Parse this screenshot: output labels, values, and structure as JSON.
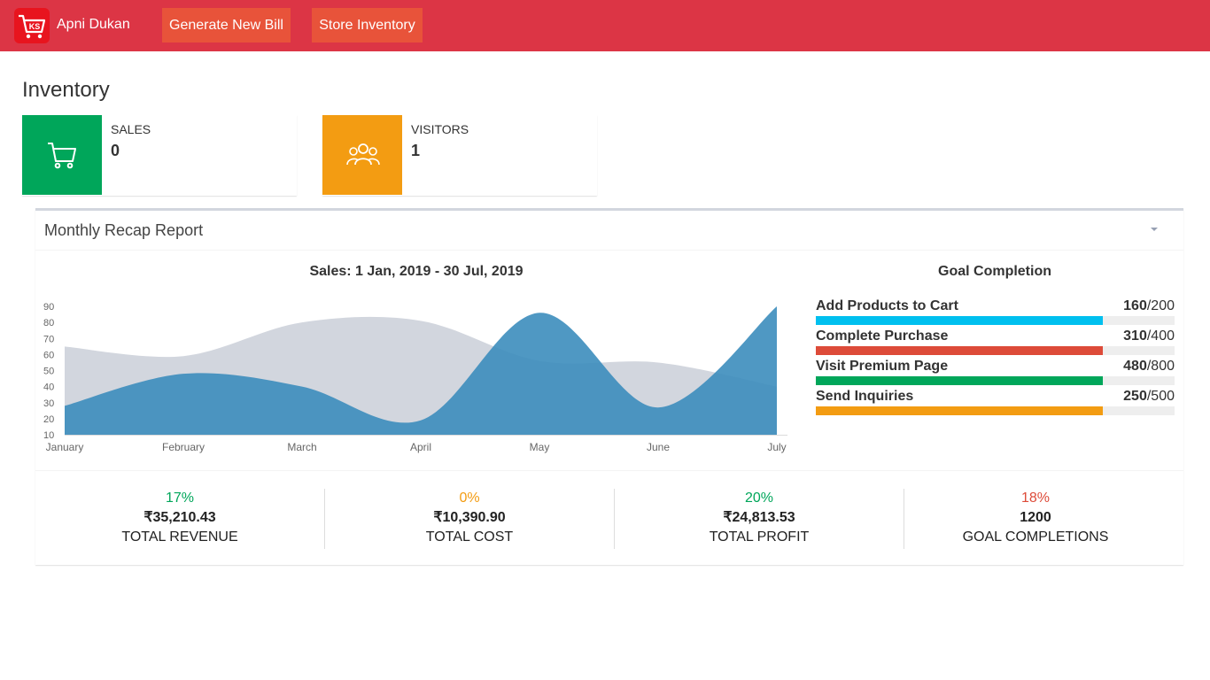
{
  "navbar": {
    "brand_name": "Apni Dukan",
    "brand_logo_text": "KS",
    "generate_bill_label": "Generate New Bill",
    "store_inventory_label": "Store Inventory"
  },
  "page": {
    "title": "Inventory"
  },
  "info_boxes": {
    "sales": {
      "label": "SALES",
      "value": "0",
      "icon": "cart-icon",
      "color": "#00a65a"
    },
    "visitors": {
      "label": "VISITORS",
      "value": "1",
      "icon": "users-icon",
      "color": "#f39c12"
    }
  },
  "report": {
    "title": "Monthly Recap Report",
    "goal_title": "Goal Completion",
    "goals": [
      {
        "label": "Add Products to Cart",
        "done": "160",
        "total": "/200",
        "ratio": 0.8,
        "color": "#00c0ef"
      },
      {
        "label": "Complete Purchase",
        "done": "310",
        "total": "/400",
        "ratio": 0.8,
        "color": "#dd4b39"
      },
      {
        "label": "Visit Premium Page",
        "done": "480",
        "total": "/800",
        "ratio": 0.8,
        "color": "#00a65a"
      },
      {
        "label": "Send Inquiries",
        "done": "250",
        "total": "/500",
        "ratio": 0.8,
        "color": "#f39c12"
      }
    ],
    "descriptions": [
      {
        "pct": "17%",
        "amount": "₹35,210.43",
        "text": "TOTAL REVENUE",
        "color": "#00a65a"
      },
      {
        "pct": "0%",
        "amount": "₹10,390.90",
        "text": "TOTAL COST",
        "color": "#f39c12"
      },
      {
        "pct": "20%",
        "amount": "₹24,813.53",
        "text": "TOTAL PROFIT",
        "color": "#00a65a"
      },
      {
        "pct": "18%",
        "amount": "1200",
        "text": "GOAL COMPLETIONS",
        "color": "#dd4b39"
      }
    ]
  },
  "chart_data": {
    "type": "area",
    "title": "Sales: 1 Jan, 2019 - 30 Jul, 2019",
    "categories": [
      "January",
      "February",
      "March",
      "April",
      "May",
      "June",
      "July"
    ],
    "yticks": [
      10,
      20,
      30,
      40,
      50,
      60,
      70,
      80,
      90
    ],
    "ylim": [
      10,
      90
    ],
    "series": [
      {
        "values": [
          65,
          59,
          80,
          81,
          56,
          55,
          40
        ],
        "color": "#d2d6de"
      },
      {
        "values": [
          28,
          48,
          40,
          19,
          86,
          27,
          90
        ],
        "color": "#3c8dbc"
      }
    ],
    "grid": false
  }
}
